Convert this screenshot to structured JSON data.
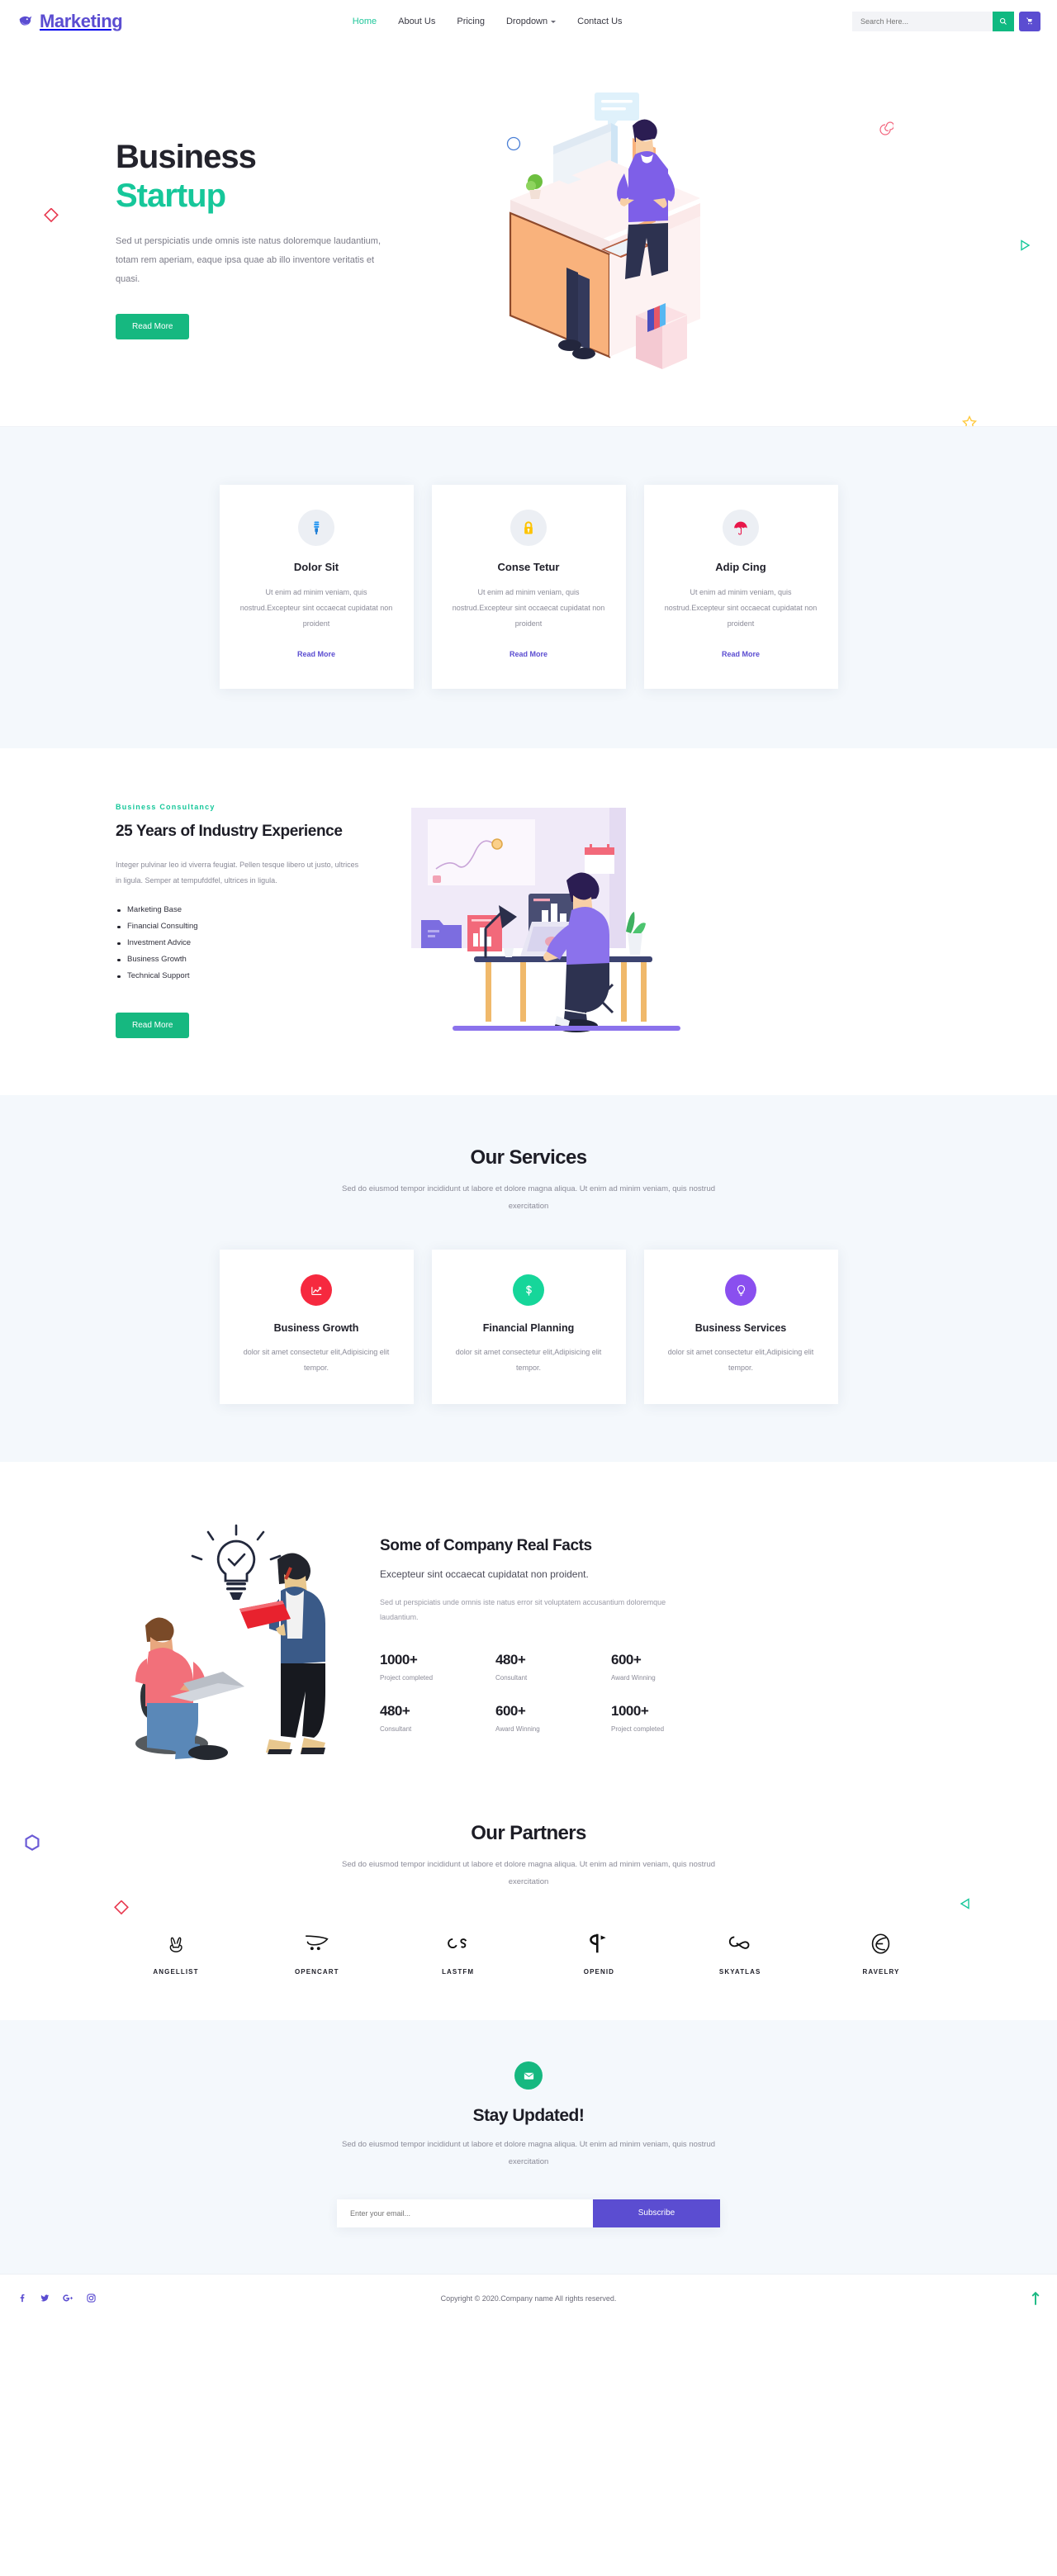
{
  "navbar": {
    "brand": "Marketing",
    "brand_color": "#5b4dd1",
    "logo_icon": "bird-logo-icon",
    "links": [
      {
        "label": "Home",
        "active": true
      },
      {
        "label": "About Us",
        "active": false
      },
      {
        "label": "Pricing",
        "active": false
      },
      {
        "label": "Dropdown",
        "active": false,
        "has_caret": true
      },
      {
        "label": "Contact Us",
        "active": false
      }
    ],
    "search_placeholder": "Search Here...",
    "search_button_icon": "search-icon",
    "search_button_color": "#10b981",
    "cart_button_icon": "cart-icon",
    "cart_button_color": "#5b4dd1"
  },
  "hero": {
    "title_line1": "Business",
    "title_line2": "Startup",
    "accent_color": "#16c79a",
    "paragraph": "Sed ut perspiciatis unde omnis iste natus doloremque laudantium, totam rem aperiam, eaque ipsa quae ab illo inventore veritatis et quasi.",
    "cta_label": "Read More",
    "illustration": "isometric-man-at-desk-illustration"
  },
  "features": {
    "cards": [
      {
        "icon": "bulb-icon",
        "icon_color": "#2196f3",
        "title": "Dolor Sit",
        "text": "Ut enim ad minim veniam, quis nostrud.Excepteur sint occaecat cupidatat non proident",
        "link": "Read More"
      },
      {
        "icon": "lock-icon",
        "icon_color": "#fdc300",
        "title": "Conse Tetur",
        "text": "Ut enim ad minim veniam, quis nostrud.Excepteur sint occaecat cupidatat non proident",
        "link": "Read More"
      },
      {
        "icon": "umbrella-icon",
        "icon_color": "#e8174a",
        "title": "Adip Cing",
        "text": "Ut enim ad minim veniam, quis nostrud.Excepteur sint occaecat cupidatat non proident",
        "link": "Read More"
      }
    ]
  },
  "experience": {
    "eyebrow": "Business Consultancy",
    "title": "25 Years of Industry Experience",
    "paragraph": "Integer pulvinar leo id viverra feugiat. Pellen tesque libero ut justo, ultrices in ligula. Semper at tempufddfel, ultrices in ligula.",
    "list": [
      "Marketing Base",
      "Financial Consulting",
      "Investment Advice",
      "Business Growth",
      "Technical Support"
    ],
    "cta_label": "Read More",
    "illustration": "man-working-at-desk-illustration"
  },
  "services": {
    "title": "Our Services",
    "subtitle": "Sed do eiusmod tempor incididunt ut labore et dolore magna aliqua. Ut enim ad minim veniam, quis nostrud exercitation",
    "cards": [
      {
        "icon": "chart-growth-icon",
        "icon_bg": "#f6293f",
        "title": "Business Growth",
        "text": "dolor sit amet consectetur elit,Adipisicing elit tempor."
      },
      {
        "icon": "dollar-icon",
        "icon_bg": "#16d69a",
        "title": "Financial Planning",
        "text": "dolor sit amet consectetur elit,Adipisicing elit tempor."
      },
      {
        "icon": "bulb-idea-icon",
        "icon_bg": "#8a4fef",
        "title": "Business Services",
        "text": "dolor sit amet consectetur elit,Adipisicing elit tempor."
      }
    ]
  },
  "facts": {
    "title": "Some of Company Real Facts",
    "lead": "Excepteur sint occaecat cupidatat non proident.",
    "paragraph": "Sed ut perspiciatis unde omnis iste natus error sit voluptatem accusantium doloremque laudantium.",
    "illustration": "two-people-working-illustration",
    "stats": [
      {
        "number": "1000+",
        "label": "Project completed"
      },
      {
        "number": "480+",
        "label": "Consultant"
      },
      {
        "number": "600+",
        "label": "Award Winning"
      },
      {
        "number": "480+",
        "label": "Consultant"
      },
      {
        "number": "600+",
        "label": "Award Winning"
      },
      {
        "number": "1000+",
        "label": "Project completed"
      }
    ]
  },
  "partners": {
    "title": "Our Partners",
    "subtitle": "Sed do eiusmod tempor incididunt ut labore et dolore magna aliqua. Ut enim ad minim veniam, quis nostrud exercitation",
    "items": [
      {
        "name": "ANGELLIST",
        "icon": "angellist-icon"
      },
      {
        "name": "OPENCART",
        "icon": "opencart-icon"
      },
      {
        "name": "LASTFM",
        "icon": "lastfm-icon"
      },
      {
        "name": "OPENID",
        "icon": "openid-icon"
      },
      {
        "name": "SKYATLAS",
        "icon": "skyatlas-icon"
      },
      {
        "name": "RAVELRY",
        "icon": "ravelry-icon"
      }
    ]
  },
  "newsletter": {
    "icon": "envelope-icon",
    "icon_bg": "#16b880",
    "title": "Stay Updated!",
    "subtitle": "Sed do eiusmod tempor incididunt ut labore et dolore magna aliqua. Ut enim ad minim veniam, quis nostrud exercitation",
    "email_placeholder": "Enter your email...",
    "submit_label": "Subscribe",
    "submit_color": "#5b4dd1"
  },
  "footer": {
    "socials": [
      {
        "name": "facebook-icon",
        "glyph": "f"
      },
      {
        "name": "twitter-icon",
        "glyph": "✈"
      },
      {
        "name": "google-plus-icon",
        "glyph": "G+"
      },
      {
        "name": "instagram-icon",
        "glyph": "◎"
      }
    ],
    "copyright": "Copyright © 2020.Company name All rights reserved.",
    "back_to_top_icon": "arrow-up-icon",
    "back_to_top_color": "#16b880"
  },
  "decorations": {
    "hero_circle_outline": "#4a7fd6",
    "hero_spiral": "#f2617a",
    "hero_square_red": "#e8374e",
    "hero_triangle_green": "#16c79a",
    "hero_star_yellow": "#ffc93c",
    "partners_hexagon": "#6b5bd6",
    "partners_square": "#e8374e",
    "partners_triangle": "#16c79a"
  }
}
